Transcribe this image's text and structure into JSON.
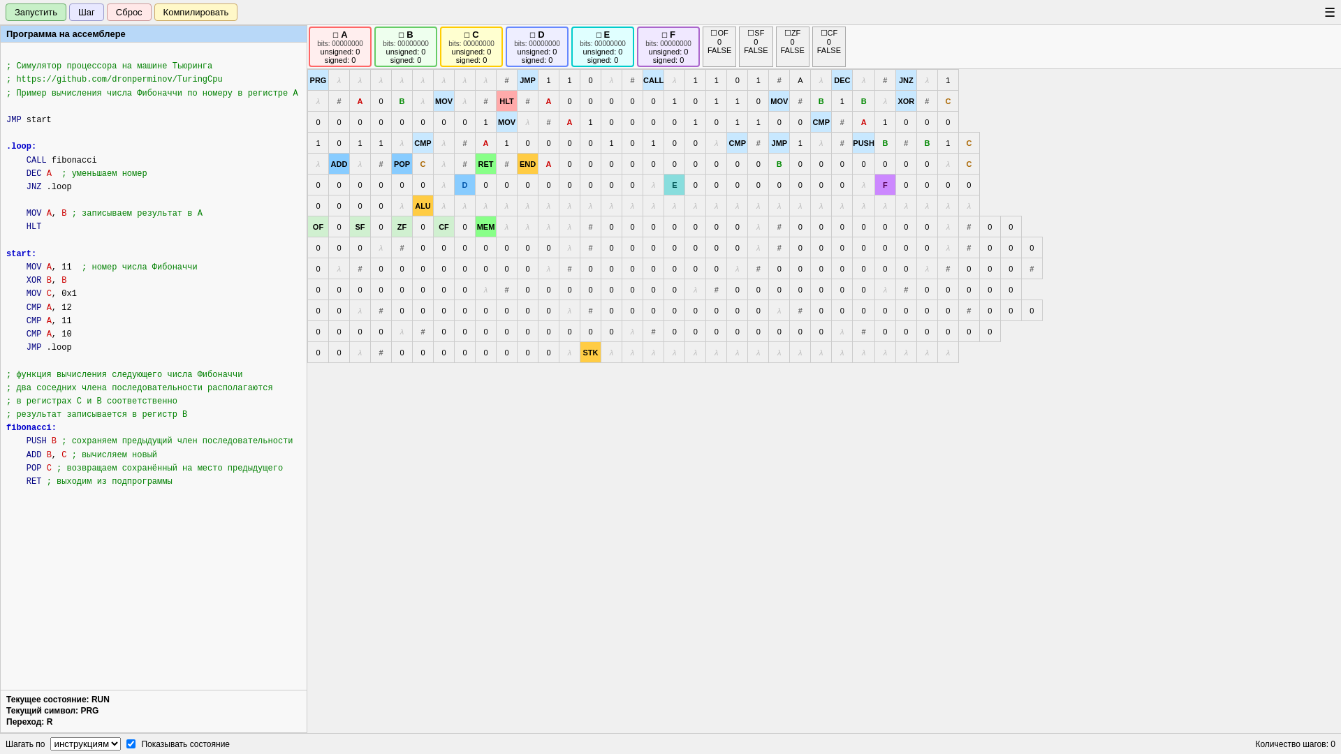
{
  "toolbar": {
    "run_label": "Запустить",
    "step_label": "Шаг",
    "reset_label": "Сброс",
    "compile_label": "Компилировать"
  },
  "code_panel": {
    "title": "Программа на ассемблере",
    "code": [
      {
        "type": "comment",
        "text": "; Симулятор процессора на машине Тьюринга"
      },
      {
        "type": "comment",
        "text": "; https://github.com/dronperminov/TuringCpu"
      },
      {
        "type": "comment",
        "text": "; Пример вычисления числа Фибоначчи по номеру в регистре A"
      },
      {
        "type": "blank"
      },
      {
        "type": "instruction",
        "text": "JMP start"
      },
      {
        "type": "blank"
      },
      {
        "type": "label",
        "text": ".loop:"
      },
      {
        "type": "instruction",
        "indent": 4,
        "parts": [
          {
            "type": "keyword",
            "text": "CALL"
          },
          {
            "type": "normal",
            "text": " fibonacci"
          }
        ]
      },
      {
        "type": "instruction",
        "indent": 4,
        "parts": [
          {
            "type": "keyword",
            "text": "DEC"
          },
          {
            "type": "register",
            "text": " A"
          },
          {
            "type": "comment",
            "text": "  ; уменьшаем номер"
          }
        ]
      },
      {
        "type": "instruction",
        "indent": 4,
        "parts": [
          {
            "type": "keyword",
            "text": "JNZ"
          },
          {
            "type": "normal",
            "text": " .loop"
          }
        ]
      },
      {
        "type": "blank"
      },
      {
        "type": "instruction",
        "indent": 4,
        "parts": [
          {
            "type": "keyword",
            "text": "MOV"
          },
          {
            "type": "register",
            "text": " A"
          },
          {
            "type": "normal",
            "text": ", "
          },
          {
            "type": "register",
            "text": "B"
          },
          {
            "type": "comment",
            "text": " ; записываем результат в A"
          }
        ]
      },
      {
        "type": "instruction",
        "indent": 4,
        "parts": [
          {
            "type": "keyword",
            "text": "HLT"
          }
        ]
      },
      {
        "type": "blank"
      },
      {
        "type": "label",
        "text": "start:"
      },
      {
        "type": "instruction",
        "indent": 4,
        "parts": [
          {
            "type": "keyword",
            "text": "MOV"
          },
          {
            "type": "register",
            "text": " A"
          },
          {
            "type": "normal",
            "text": ", 11"
          },
          {
            "type": "comment",
            "text": "  ; номер числа Фибоначчи"
          }
        ]
      },
      {
        "type": "instruction",
        "indent": 4,
        "parts": [
          {
            "type": "keyword",
            "text": "XOR"
          },
          {
            "type": "register",
            "text": " B"
          },
          {
            "type": "normal",
            "text": ", "
          },
          {
            "type": "register",
            "text": "B"
          }
        ]
      },
      {
        "type": "instruction",
        "indent": 4,
        "parts": [
          {
            "type": "keyword",
            "text": "MOV"
          },
          {
            "type": "register",
            "text": " C"
          },
          {
            "type": "normal",
            "text": ", 0x1"
          }
        ]
      },
      {
        "type": "instruction",
        "indent": 4,
        "parts": [
          {
            "type": "keyword",
            "text": "CMP"
          },
          {
            "type": "register",
            "text": " A"
          },
          {
            "type": "normal",
            "text": ", 12"
          }
        ]
      },
      {
        "type": "instruction",
        "indent": 4,
        "parts": [
          {
            "type": "keyword",
            "text": "CMP"
          },
          {
            "type": "register",
            "text": " A"
          },
          {
            "type": "normal",
            "text": ", 11"
          }
        ]
      },
      {
        "type": "instruction",
        "indent": 4,
        "parts": [
          {
            "type": "keyword",
            "text": "CMP"
          },
          {
            "type": "register",
            "text": " A"
          },
          {
            "type": "normal",
            "text": ", 10"
          }
        ]
      },
      {
        "type": "instruction",
        "indent": 4,
        "parts": [
          {
            "type": "keyword",
            "text": "JMP"
          },
          {
            "type": "normal",
            "text": " .loop"
          }
        ]
      },
      {
        "type": "blank"
      },
      {
        "type": "comment",
        "text": "; функция вычисления следующего числа Фибоначчи"
      },
      {
        "type": "comment",
        "text": "; два соседних члена последовательности располагаются"
      },
      {
        "type": "comment",
        "text": "; в регистрах C и B соответственно"
      },
      {
        "type": "comment",
        "text": "; результат записывается в регистр B"
      },
      {
        "type": "label",
        "text": "fibonacci:"
      },
      {
        "type": "instruction",
        "indent": 4,
        "parts": [
          {
            "type": "keyword",
            "text": "PUSH"
          },
          {
            "type": "register",
            "text": " B"
          },
          {
            "type": "comment",
            "text": " ; сохраняем предыдущий член последовательности"
          }
        ]
      },
      {
        "type": "instruction",
        "indent": 4,
        "parts": [
          {
            "type": "keyword",
            "text": "ADD"
          },
          {
            "type": "register",
            "text": " B"
          },
          {
            "type": "normal",
            "text": ", "
          },
          {
            "type": "register",
            "text": "C"
          },
          {
            "type": "comment",
            "text": " ; вычисляем новый"
          }
        ]
      },
      {
        "type": "instruction",
        "indent": 4,
        "parts": [
          {
            "type": "keyword",
            "text": "POP"
          },
          {
            "type": "register",
            "text": " C"
          },
          {
            "type": "comment",
            "text": " ; возвращаем сохранённый на место предыдущего"
          }
        ]
      },
      {
        "type": "instruction",
        "indent": 4,
        "parts": [
          {
            "type": "keyword",
            "text": "RET"
          },
          {
            "type": "comment",
            "text": " ; выходим из подпрограммы"
          }
        ]
      }
    ]
  },
  "registers": {
    "A": {
      "bits": "00000000",
      "unsigned": 0,
      "signed": 0
    },
    "B": {
      "bits": "00000000",
      "unsigned": 0,
      "signed": 0
    },
    "C": {
      "bits": "00000000",
      "unsigned": 0,
      "signed": 0
    },
    "D": {
      "bits": "00000000",
      "unsigned": 0,
      "signed": 0
    },
    "E": {
      "bits": "00000000",
      "unsigned": 0,
      "signed": 0
    },
    "F": {
      "bits": "00000000",
      "unsigned": 0,
      "signed": 0
    },
    "OF": {
      "value": 0,
      "bool": "FALSE"
    },
    "SF": {
      "value": 0,
      "bool": "FALSE"
    },
    "ZF": {
      "value": 0,
      "bool": "FALSE"
    },
    "CF": {
      "value": 0,
      "bool": "FALSE"
    }
  },
  "status": {
    "state_label": "Текущее состояние:",
    "state_value": "RUN",
    "symbol_label": "Текущий символ:",
    "symbol_value": "PRG",
    "transition_label": "Переход:",
    "transition_value": "R"
  },
  "bottom": {
    "step_by_label": "Шагать по",
    "step_by_option": "инструкциям",
    "show_state_label": "Показывать состояние",
    "step_count_label": "Количество шагов:",
    "step_count": 0
  }
}
